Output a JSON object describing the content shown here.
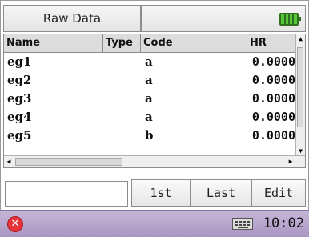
{
  "header": {
    "title": "Raw Data"
  },
  "table": {
    "columns": [
      "Name",
      "Type",
      "Code",
      "HR"
    ],
    "rows": [
      {
        "name": "eg1",
        "type": "",
        "code": "a",
        "hr": "0.0000"
      },
      {
        "name": "eg2",
        "type": "",
        "code": "a",
        "hr": "0.0000"
      },
      {
        "name": "eg3",
        "type": "",
        "code": "a",
        "hr": "0.0000"
      },
      {
        "name": "eg4",
        "type": "",
        "code": "a",
        "hr": "0.0000"
      },
      {
        "name": "eg5",
        "type": "",
        "code": "b",
        "hr": "0.0000"
      }
    ]
  },
  "controls": {
    "search_value": "",
    "first_label": "1st",
    "last_label": "Last",
    "edit_label": "Edit"
  },
  "taskbar": {
    "time": "10:02"
  },
  "icons": {
    "battery": "battery-icon",
    "close": "close-icon",
    "keyboard": "keyboard-icon"
  },
  "colors": {
    "battery_fill": "#55c63a",
    "close_red": "#e8333b",
    "taskbar": "#b7a6cd"
  }
}
